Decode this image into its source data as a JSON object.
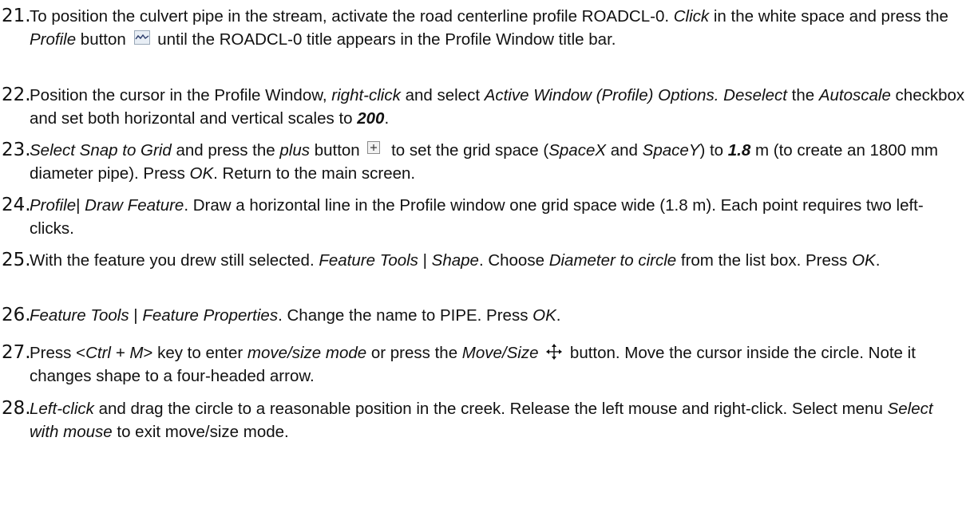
{
  "steps": [
    {
      "n": "21.",
      "parts": [
        {
          "t": "To position the culvert pipe in the stream, activate the road centerline profile ROADCL-0. "
        },
        {
          "t": "Click",
          "i": true
        },
        {
          "t": " in the white space and press the "
        },
        {
          "t": "Profile",
          "i": true
        },
        {
          "t": " button "
        },
        {
          "icon": "profile-icon"
        },
        {
          "t": "  until the ROADCL-0 title appears in the Profile Window title bar."
        }
      ]
    },
    {
      "n": "22.",
      "parts": [
        {
          "t": "Position the cursor in the Profile Window, "
        },
        {
          "t": "right-click",
          "i": true
        },
        {
          "t": " and select "
        },
        {
          "t": "Active Window (Profile) Options. Deselect",
          "i": true
        },
        {
          "t": " the "
        },
        {
          "t": "Autoscale",
          "i": true
        },
        {
          "t": " checkbox and set both horizontal and vertical scales to "
        },
        {
          "t": "200",
          "i": true,
          "b": true
        },
        {
          "t": "."
        }
      ]
    },
    {
      "n": "23.",
      "parts": [
        {
          "t": "Select Snap to Grid",
          "i": true
        },
        {
          "t": " and press the "
        },
        {
          "t": "plus",
          "i": true
        },
        {
          "t": " button "
        },
        {
          "icon": "plus-icon"
        },
        {
          "t": " to set the grid space ("
        },
        {
          "t": "SpaceX",
          "i": true
        },
        {
          "t": " and "
        },
        {
          "t": "SpaceY",
          "i": true
        },
        {
          "t": ") to "
        },
        {
          "t": "1.8",
          "i": true,
          "b": true
        },
        {
          "t": " m (to create an 1800 mm diameter pipe). Press "
        },
        {
          "t": "OK",
          "i": true
        },
        {
          "t": ". Return to the main screen."
        }
      ]
    },
    {
      "n": "24.",
      "parts": [
        {
          "t": "Profile",
          "i": true
        },
        {
          "t": "| "
        },
        {
          "t": "Draw Feature",
          "i": true
        },
        {
          "t": ". Draw a horizontal line in the Profile window one grid space wide (1.8 m). Each point requires two left-clicks."
        }
      ]
    },
    {
      "n": "25.",
      "parts": [
        {
          "t": "With the feature you drew still selected.  "
        },
        {
          "t": "Feature Tools",
          "i": true
        },
        {
          "t": " | "
        },
        {
          "t": "Shape",
          "i": true
        },
        {
          "t": ". Choose "
        },
        {
          "t": "Diameter to circle",
          "i": true
        },
        {
          "t": " from the list box. Press "
        },
        {
          "t": "OK",
          "i": true
        },
        {
          "t": "."
        }
      ]
    },
    {
      "n": "26.",
      "parts": [
        {
          "t": "Feature Tools",
          "i": true
        },
        {
          "t": " | "
        },
        {
          "t": "Feature Properties",
          "i": true
        },
        {
          "t": ". Change the name to PIPE. Press "
        },
        {
          "t": "OK",
          "i": true
        },
        {
          "t": "."
        }
      ]
    },
    {
      "n": "27.",
      "parts": [
        {
          "t": "Press <"
        },
        {
          "t": "Ctrl + M",
          "i": true
        },
        {
          "t": "> key to enter "
        },
        {
          "t": "move/size mode",
          "i": true
        },
        {
          "t": " or press the "
        },
        {
          "t": "Move/Size",
          "i": true
        },
        {
          "t": " "
        },
        {
          "icon": "move-icon"
        },
        {
          "t": " button. Move the cursor inside the circle. Note it changes shape to a four-headed arrow."
        }
      ]
    },
    {
      "n": "28.",
      "parts": [
        {
          "t": "Left-click",
          "i": true
        },
        {
          "t": " and drag the circle to a reasonable position in the creek. Release the left mouse and right-click. Select menu "
        },
        {
          "t": "Select with mouse",
          "i": true
        },
        {
          "t": " to exit move/size mode."
        }
      ]
    }
  ]
}
